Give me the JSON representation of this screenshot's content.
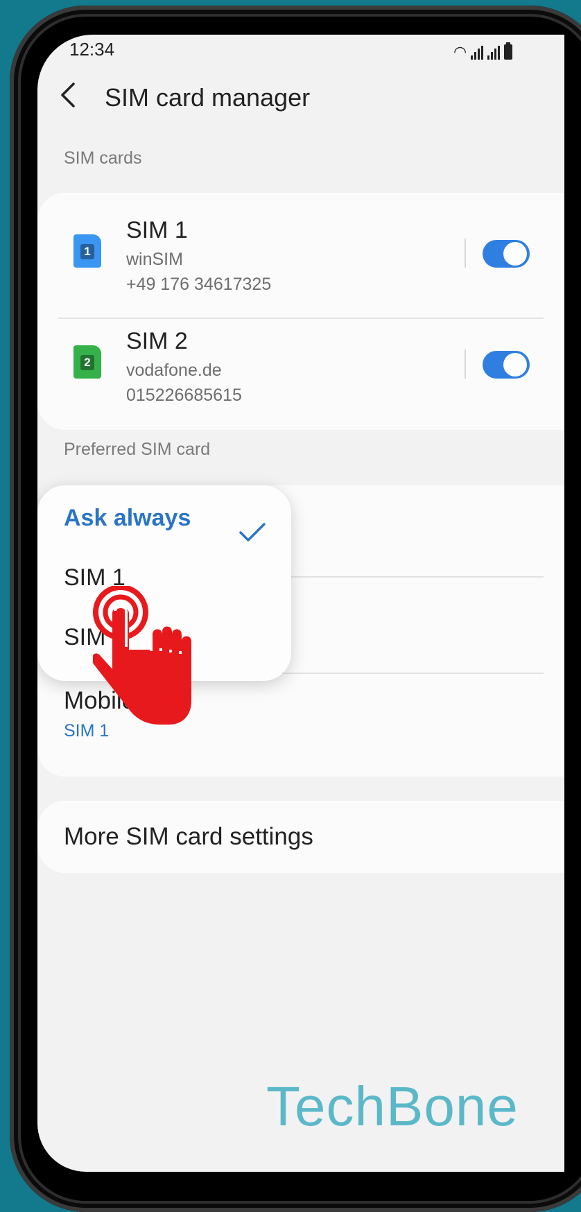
{
  "status_bar": {
    "time": "12:34"
  },
  "header": {
    "title": "SIM card manager"
  },
  "sim_cards": {
    "section_label": "SIM cards",
    "items": [
      {
        "name": "SIM 1",
        "carrier": "winSIM",
        "number": "+49 176 34617325",
        "icon_digit": "1",
        "icon_color": "#3a96f0",
        "enabled": true
      },
      {
        "name": "SIM 2",
        "carrier": "vodafone.de",
        "number": "015226685615",
        "icon_digit": "2",
        "icon_color": "#35b14a",
        "enabled": true
      }
    ]
  },
  "preferred": {
    "section_label": "Preferred SIM card",
    "mobile_data_title": "Mobile data",
    "mobile_data_value": "SIM 1"
  },
  "dropdown": {
    "options": [
      "Ask always",
      "SIM 1",
      "SIM 2"
    ],
    "selected": "Ask always"
  },
  "more_settings": {
    "label": "More SIM card settings"
  },
  "watermark": "TechBone",
  "colors": {
    "accent": "#2a74c7",
    "toggle": "#2f7fe0",
    "background": "#127a8c",
    "tap_hand": "#e8191c"
  }
}
